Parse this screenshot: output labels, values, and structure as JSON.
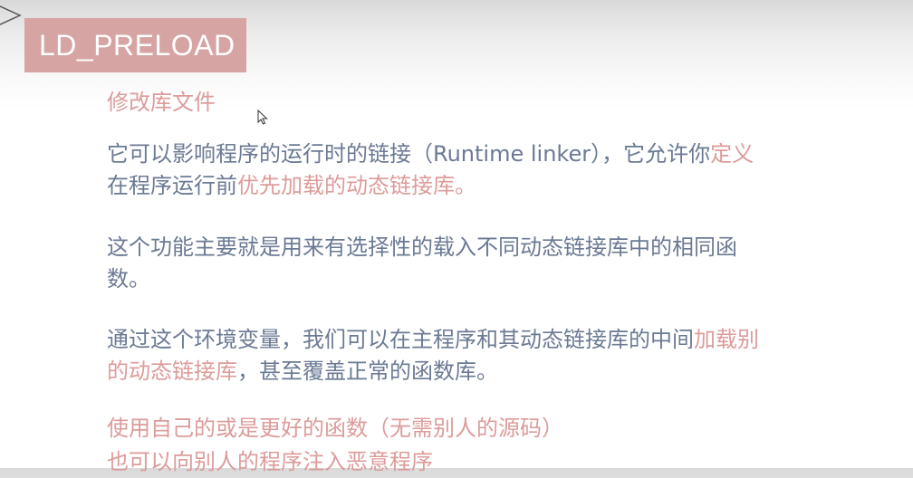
{
  "slide": {
    "title": "LD_PRELOAD",
    "subheading": "修改库文件",
    "paragraph1": {
      "text_normal": "它可以影响程序的运行时的链接（Runtime linker），它允许你",
      "text_pink_a": "定义",
      "text_normal_b": "在程序运行前",
      "text_pink_b": "优先加载的动态链接库。"
    },
    "paragraph2": "这个功能主要就是用来有选择性的载入不同动态链接库中的相同函数。",
    "paragraph3": {
      "text_normal": "通过这个环境变量，我们可以在主程序和其动态链接库的中间",
      "text_pink": "加载别的动态链接库",
      "text_normal_b": "，甚至覆盖正常的函数库。"
    },
    "bullet1": "使用自己的或是更好的函数（无需别人的源码）",
    "bullet2": "也可以向别人的程序注入恶意程序"
  },
  "colors": {
    "accent_pink": "#dc9c9a",
    "title_box": "#d6a4a3",
    "body_text": "#6b7a94"
  },
  "icons": {
    "corner": "triangle-arrow-icon",
    "pointer": "mouse-cursor-icon"
  }
}
